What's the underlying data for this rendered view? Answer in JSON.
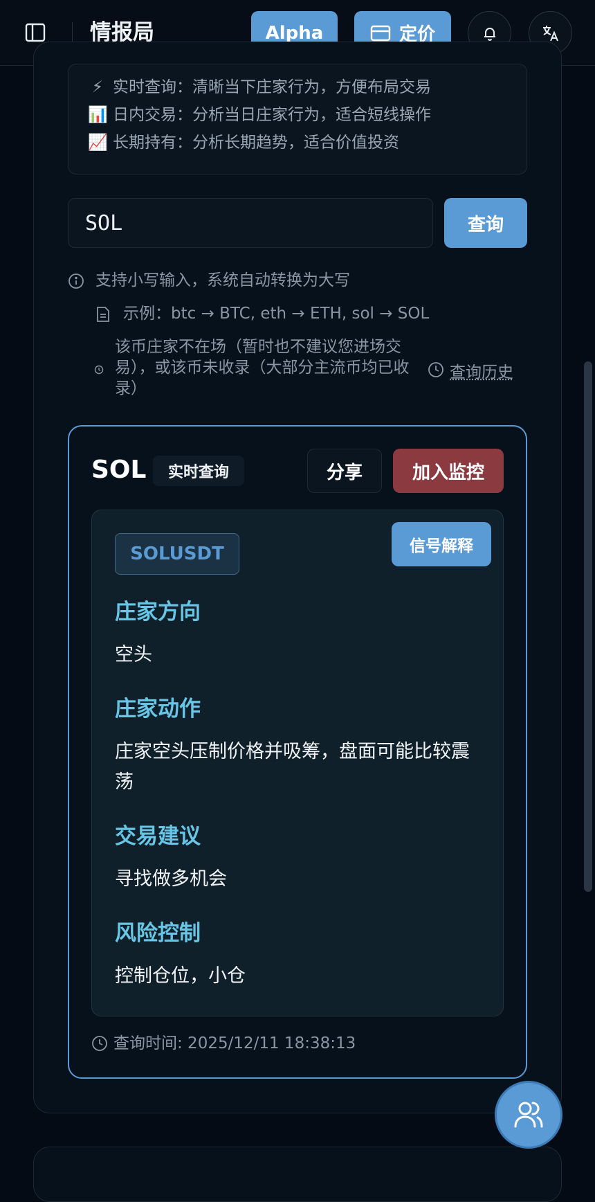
{
  "header": {
    "title": "情报局",
    "alpha_label": "Alpha",
    "pricing_label": "定价"
  },
  "info": {
    "lines": [
      {
        "emoji": "⚡",
        "text": "实时查询：清晰当下庄家行为，方便布局交易"
      },
      {
        "emoji": "📊",
        "text": "日内交易：分析当日庄家行为，适合短线操作"
      },
      {
        "emoji": "📈",
        "text": "长期持有：分析长期趋势，适合价值投资"
      }
    ]
  },
  "search": {
    "value": "SOL",
    "button_label": "查询"
  },
  "hints": {
    "uppercase": "支持小写输入，系统自动转换为大写",
    "example": "示例：btc → BTC, eth → ETH, sol → SOL",
    "not_present": "该币庄家不在场（暂时也不建议您进场交易），或该币未收录（大部分主流币均已收录）",
    "history_link": "查询历史"
  },
  "result": {
    "symbol": "SOL",
    "mode_badge": "实时查询",
    "share_label": "分享",
    "monitor_label": "加入监控",
    "pair": "SOLUSDT",
    "explain_label": "信号解释",
    "sections": [
      {
        "title": "庄家方向",
        "value": "空头"
      },
      {
        "title": "庄家动作",
        "value": "庄家空头压制价格并吸筹，盘面可能比较震荡"
      },
      {
        "title": "交易建议",
        "value": "寻找做多机会"
      },
      {
        "title": "风险控制",
        "value": "控制仓位，小仓"
      }
    ],
    "query_time": "查询时间: 2025/12/11 18:38:13"
  },
  "icons": {
    "sidebar": "sidebar-toggle-icon",
    "card": "credit-card-icon",
    "bell": "bell-icon",
    "language": "translate-icon",
    "info": "info-icon",
    "document": "document-icon",
    "clock": "clock-icon",
    "users": "users-icon"
  },
  "colors": {
    "accent": "#5b9bd5",
    "danger": "#8b3a40",
    "section_title": "#67c6e6",
    "background": "#050b14"
  }
}
